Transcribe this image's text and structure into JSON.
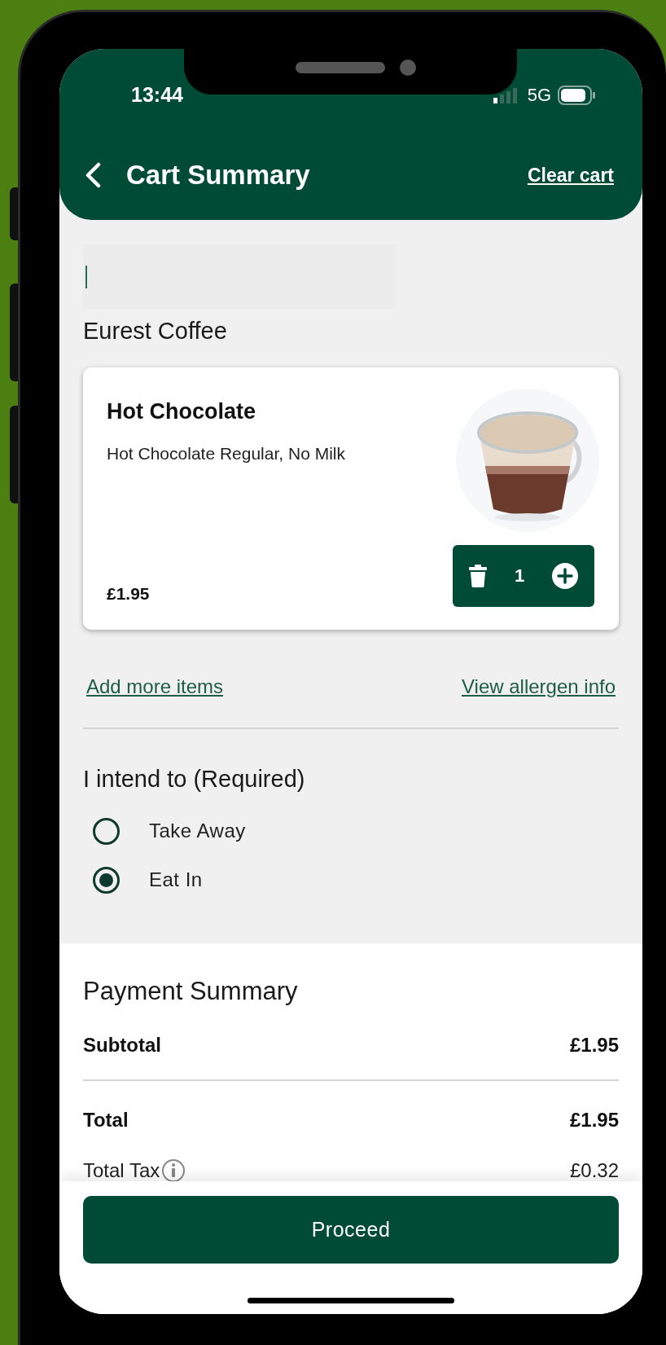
{
  "status_bar": {
    "time": "13:44",
    "network": "5G"
  },
  "header": {
    "title": "Cart Summary",
    "action": "Clear cart"
  },
  "store_name": "Eurest Coffee",
  "cart_items": [
    {
      "name": "Hot Chocolate",
      "description": "Hot Chocolate Regular, No Milk",
      "price": "£1.95",
      "quantity": "1"
    }
  ],
  "links": [
    "Add more items",
    "View allergen info"
  ],
  "intent": {
    "label": "I intend to (Required)",
    "options": [
      {
        "label": "Take Away",
        "selected": false
      },
      {
        "label": "Eat In",
        "selected": true
      }
    ]
  },
  "payment_summary": {
    "title": "Payment Summary",
    "rows": [
      {
        "kind": "subtotal",
        "label": "Subtotal",
        "value": "£1.95"
      },
      {
        "kind": "total",
        "label": "Total",
        "value": "£1.95"
      },
      {
        "kind": "tax",
        "label": "Total Tax",
        "value": "£0.32"
      }
    ]
  },
  "primary_button": "Proceed"
}
